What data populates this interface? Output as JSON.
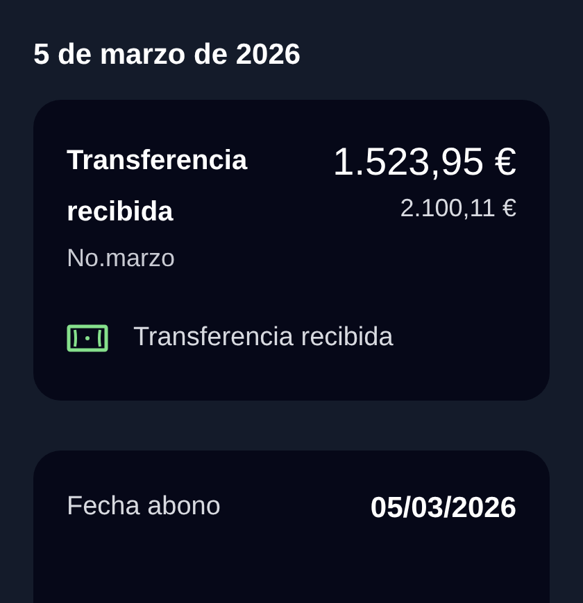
{
  "date_heading": "5 de marzo de 2026",
  "transaction": {
    "title": "Transferencia recibida",
    "amount": "1.523,95 €",
    "balance": "2.100,11 €",
    "concept": "No.marzo",
    "category": {
      "kind": "banknote",
      "label": "Transferencia recibida"
    }
  },
  "details": [
    {
      "label": "Fecha abono",
      "value": "05/03/2026"
    }
  ]
}
